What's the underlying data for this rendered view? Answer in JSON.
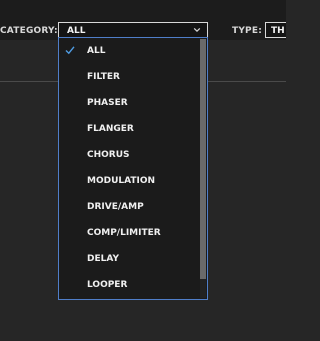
{
  "filters": {
    "category": {
      "label": "CATEGORY:",
      "selected": "ALL"
    },
    "type": {
      "label": "TYPE:",
      "selected": "TH"
    }
  },
  "dropdown": {
    "options": [
      {
        "label": "ALL",
        "checked": true
      },
      {
        "label": "FILTER"
      },
      {
        "label": "PHASER"
      },
      {
        "label": "FLANGER"
      },
      {
        "label": "CHORUS"
      },
      {
        "label": "MODULATION"
      },
      {
        "label": "DRIVE/AMP"
      },
      {
        "label": "COMP/LIMITER"
      },
      {
        "label": "DELAY"
      },
      {
        "label": "LOOPER"
      }
    ]
  },
  "colors": {
    "accent_border": "#4f7ec9",
    "check_color": "#4f9ce3",
    "background": "#262626"
  },
  "icons": {
    "checkmark": "checkmark-icon",
    "chevron": "chevron-down-icon"
  }
}
